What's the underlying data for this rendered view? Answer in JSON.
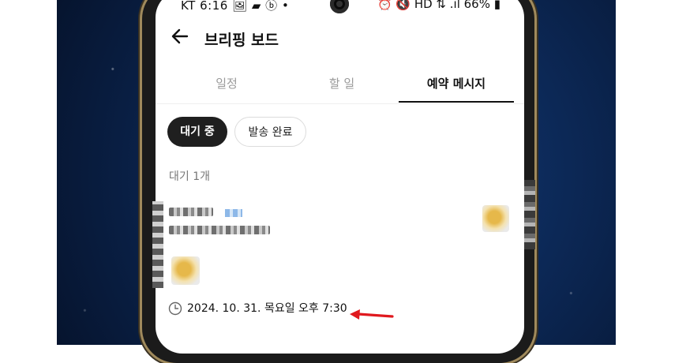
{
  "status_bar": {
    "left": "KT 6:16 🖼 ▰ ⓑ •",
    "right": "⏰ 🔇 HD ⇅ .ıl 66% ▮"
  },
  "header": {
    "title": "브리핑 보드"
  },
  "tabs": [
    {
      "label": "일정",
      "active": false
    },
    {
      "label": "할 일",
      "active": false
    },
    {
      "label": "예약 메시지",
      "active": true
    }
  ],
  "filters": [
    {
      "label": "대기 중",
      "active": true
    },
    {
      "label": "발송 완료",
      "active": false
    }
  ],
  "list": {
    "count_label": "대기 1개"
  },
  "message": {
    "scheduled_time": "2024. 10. 31. 목요일 오후 7:30"
  },
  "icons": {
    "back": "arrow-left-icon",
    "clock": "clock-icon",
    "annotation": "red-arrow-icon"
  },
  "colors": {
    "accent": "#1f1f1f",
    "annotation": "#e0191e"
  }
}
